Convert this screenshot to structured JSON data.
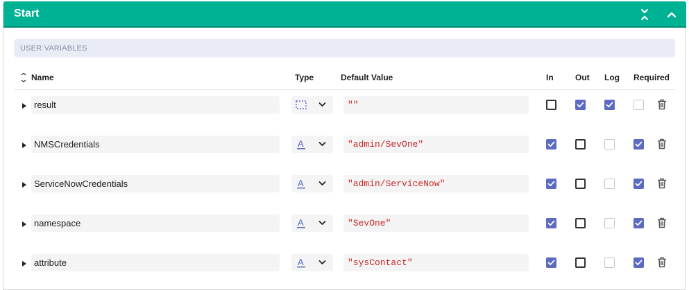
{
  "panel": {
    "title": "Start",
    "accent_color": "#00b294"
  },
  "section": {
    "label": "USER VARIABLES"
  },
  "columns": {
    "name": "Name",
    "type": "Type",
    "default_value": "Default Value",
    "in": "In",
    "out": "Out",
    "log": "Log",
    "required": "Required"
  },
  "rows": [
    {
      "name": "result",
      "type_icon": "object-type-icon",
      "default_value": "\"\"",
      "in": false,
      "out": true,
      "log": true,
      "required": false
    },
    {
      "name": "NMSCredentials",
      "type_icon": "string-type-icon",
      "default_value": "\"admin/SevOne\"",
      "in": true,
      "out": false,
      "log": false,
      "required": true
    },
    {
      "name": "ServiceNowCredentials",
      "type_icon": "string-type-icon",
      "default_value": "\"admin/ServiceNow\"",
      "in": true,
      "out": false,
      "log": false,
      "required": true
    },
    {
      "name": "namespace",
      "type_icon": "string-type-icon",
      "default_value": "\"SevOne\"",
      "in": true,
      "out": false,
      "log": false,
      "required": true
    },
    {
      "name": "attribute",
      "type_icon": "string-type-icon",
      "default_value": "\"sysContact\"",
      "in": true,
      "out": false,
      "log": false,
      "required": true
    }
  ]
}
